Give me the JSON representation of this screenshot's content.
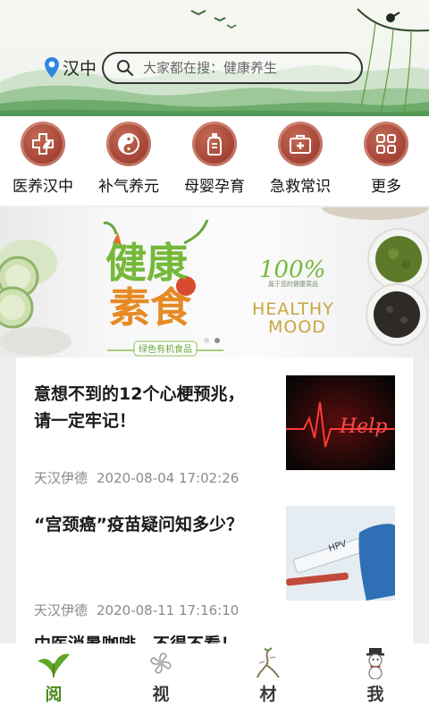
{
  "header": {
    "location": "汉中",
    "location_icon": "location-pin-icon",
    "search_placeholder": "大家都在搜：健康养生",
    "accent_color": "#2f87e0"
  },
  "categories": [
    {
      "label": "医养汉中",
      "icon": "medical-cross-leaf-icon"
    },
    {
      "label": "补气养元",
      "icon": "yin-yang-icon"
    },
    {
      "label": "母婴孕育",
      "icon": "baby-bottle-icon"
    },
    {
      "label": "急救常识",
      "icon": "first-aid-kit-icon"
    },
    {
      "label": "更多",
      "icon": "grid-more-icon"
    }
  ],
  "banner": {
    "headline_1": "健康",
    "headline_2": "素食",
    "tagline": "绿色有机食品",
    "percent": "100%",
    "percent_sub": "属于您的健康菜品",
    "mood_line_1": "HEALTHY",
    "mood_line_2": "MOOD",
    "slide_count": 2,
    "active_slide": 2
  },
  "articles": [
    {
      "title": "意想不到的12个心梗预兆，请一定牢记！",
      "author": "天汉伊德",
      "date": "2020-08-04 17:02:26",
      "thumb_text": "Help"
    },
    {
      "title": "“宫颈癌”疫苗疑问知多少？",
      "author": "天汉伊德",
      "date": "2020-08-11 17:16:10",
      "thumb_text": "HPV"
    },
    {
      "title": "中医消暑咖啡，不得不看！",
      "author": "",
      "date": ""
    }
  ],
  "tabs": [
    {
      "label": "阅",
      "icon": "green-leaf-icon",
      "active": true
    },
    {
      "label": "视",
      "icon": "pinwheel-flower-icon",
      "active": false
    },
    {
      "label": "材",
      "icon": "ginseng-root-icon",
      "active": false
    },
    {
      "label": "我",
      "icon": "snowman-icon",
      "active": false
    }
  ],
  "colors": {
    "active_tab": "#4a8a1c",
    "category_circle": "#a9483a",
    "meta_text": "#8a8a8a"
  }
}
